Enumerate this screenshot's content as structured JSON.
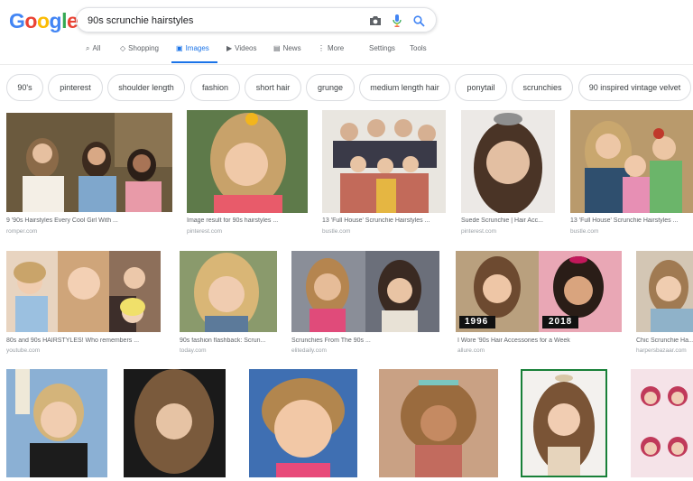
{
  "logo": {
    "letters": [
      "G",
      "o",
      "o",
      "g",
      "l",
      "e"
    ],
    "colors": [
      "#4285f4",
      "#ea4335",
      "#fbbc05",
      "#4285f4",
      "#34a853",
      "#ea4335"
    ]
  },
  "search": {
    "query": "90s scrunchie hairstyles"
  },
  "tabs": [
    {
      "label": "All",
      "icon": "search-icon"
    },
    {
      "label": "Shopping",
      "icon": "tag-icon"
    },
    {
      "label": "Images",
      "icon": "image-icon",
      "active": true
    },
    {
      "label": "Videos",
      "icon": "play-icon"
    },
    {
      "label": "News",
      "icon": "newspaper-icon"
    },
    {
      "label": "More",
      "icon": "more-vert-icon"
    },
    {
      "label": "Settings"
    },
    {
      "label": "Tools"
    }
  ],
  "chips": [
    "90's",
    "pinterest",
    "shoulder length",
    "fashion",
    "short hair",
    "grunge",
    "medium length hair",
    "ponytail",
    "scrunchies",
    "90 inspired vintage velvet"
  ],
  "results": [
    {
      "title": "9 '90s Hairstyles Every Cool Girl With ...",
      "source": "romper.com"
    },
    {
      "title": "Image result for 90s hairstyles ...",
      "source": "pinterest.com"
    },
    {
      "title": "13 'Full House' Scrunchie Hairstyles ...",
      "source": "bustle.com"
    },
    {
      "title": "Suede Scrunchie | Hair Acc...",
      "source": "pinterest.com"
    },
    {
      "title": "13 'Full House' Scrunchie Hairstyles ...",
      "source": "bustle.com"
    },
    {
      "title": "80s and 90s HAIRSTYLES! Who remembers ...",
      "source": "youtube.com"
    },
    {
      "title": "90s fashion flashback: Scrun...",
      "source": "today.com"
    },
    {
      "title": "Scrunchies From The 90s ...",
      "source": "elitedaily.com"
    },
    {
      "title": "I Wore '90s Hair Accessories for a Week",
      "source": "allure.com",
      "overlay": [
        "1996",
        "2018"
      ]
    },
    {
      "title": "Chic Scrunchie Ha...",
      "source": "harpersbazaar.com"
    },
    {
      "title": "",
      "source": ""
    },
    {
      "title": "",
      "source": ""
    },
    {
      "title": "",
      "source": ""
    },
    {
      "title": "",
      "source": ""
    },
    {
      "title": "",
      "source": ""
    },
    {
      "title": "",
      "source": ""
    }
  ]
}
